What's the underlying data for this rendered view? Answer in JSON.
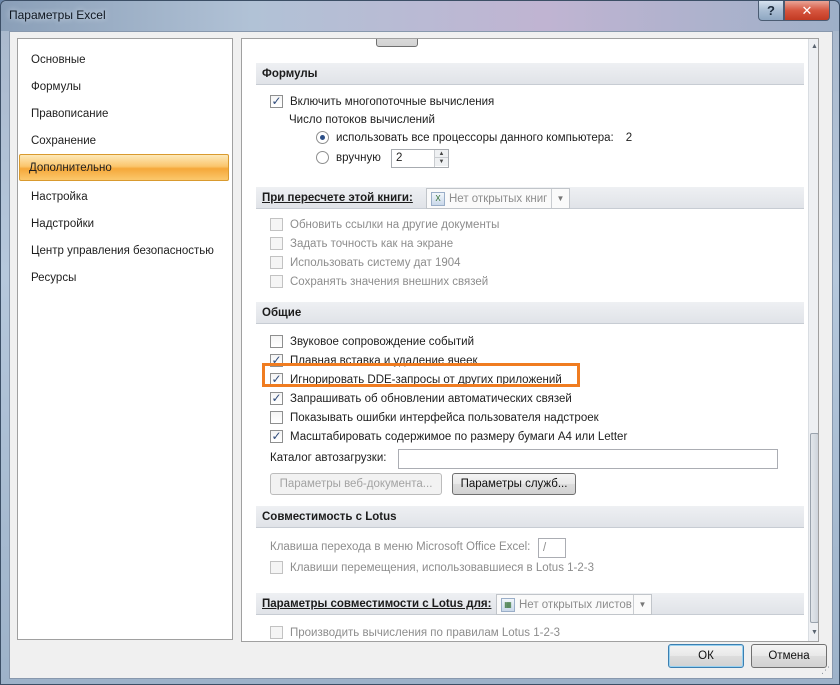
{
  "window": {
    "title": "Параметры Excel",
    "help": "?",
    "close": "✕"
  },
  "nav": {
    "items": [
      {
        "label": "Основные"
      },
      {
        "label": "Формулы"
      },
      {
        "label": "Правописание"
      },
      {
        "label": "Сохранение"
      },
      {
        "label": "Дополнительно",
        "active": true
      },
      {
        "label": "Настройка"
      },
      {
        "label": "Надстройки"
      },
      {
        "label": "Центр управления безопасностью"
      },
      {
        "label": "Ресурсы"
      }
    ]
  },
  "sections": {
    "formulas": {
      "header": "Формулы",
      "multithread": {
        "label": "Включить многопоточные вычисления",
        "checked": true
      },
      "threads_label": "Число потоков вычислений",
      "use_all": {
        "label": "использовать все процессоры данного компьютера:",
        "value": "2",
        "selected": true
      },
      "manual": {
        "label": "вручную",
        "value": "2",
        "selected": false
      }
    },
    "recalc": {
      "header": "При пересчете этой книги:",
      "combo": "Нет открытых книг",
      "options": [
        {
          "label": "Обновить ссылки на другие документы",
          "checked": false
        },
        {
          "label": "Задать точность как на экране",
          "checked": false
        },
        {
          "label": "Использовать систему дат 1904",
          "checked": false
        },
        {
          "label": "Сохранять значения внешних связей",
          "checked": false
        }
      ]
    },
    "general": {
      "header": "Общие",
      "options": [
        {
          "label": "Звуковое сопровождение событий",
          "checked": false
        },
        {
          "label": "Плавная вставка и удаление ячеек",
          "checked": true
        },
        {
          "label": "Игнорировать DDE-запросы от других приложений",
          "checked": true
        },
        {
          "label": "Запрашивать об обновлении автоматических связей",
          "checked": true
        },
        {
          "label": "Показывать ошибки интерфейса пользователя надстроек",
          "checked": false
        },
        {
          "label": "Масштабировать содержимое по размеру бумаги A4 или Letter",
          "checked": true
        }
      ],
      "startup_label": "Каталог автозагрузки:",
      "startup_value": "",
      "web_options": "Параметры веб-документа...",
      "service_options": "Параметры служб..."
    },
    "lotus": {
      "header": "Совместимость с Lotus",
      "menu_key_label": "Клавиша перехода в меню Microsoft Office Excel:",
      "menu_key_value": "/",
      "nav_keys": {
        "label": "Клавиши перемещения, использовавшиеся в Lotus 1-2-3",
        "checked": false
      }
    },
    "lotus_params": {
      "header": "Параметры совместимости с Lotus для:",
      "combo": "Нет открытых листов",
      "formula_eval": {
        "label": "Производить вычисления по правилам Lotus 1-2-3",
        "checked": false
      }
    }
  },
  "footer": {
    "ok": "ОК",
    "cancel": "Отмена"
  },
  "colors": {
    "highlight": "#f07c20",
    "active_nav": "#fbc66d"
  }
}
